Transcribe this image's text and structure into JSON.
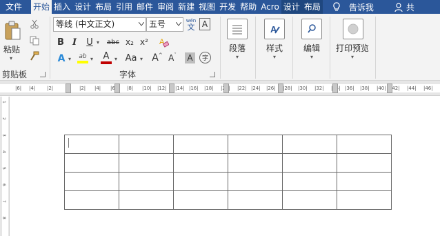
{
  "tabs": [
    {
      "label": "文件",
      "state": "normal"
    },
    {
      "label": "开始",
      "state": "active"
    },
    {
      "label": "插入",
      "state": "normal"
    },
    {
      "label": "设计",
      "state": "normal"
    },
    {
      "label": "布局",
      "state": "normal"
    },
    {
      "label": "引用",
      "state": "normal"
    },
    {
      "label": "邮件",
      "state": "normal"
    },
    {
      "label": "审阅",
      "state": "normal"
    },
    {
      "label": "新建",
      "state": "normal"
    },
    {
      "label": "视图",
      "state": "normal"
    },
    {
      "label": "开发",
      "state": "normal"
    },
    {
      "label": "帮助",
      "state": "normal"
    },
    {
      "label": "Acro",
      "state": "normal"
    },
    {
      "label": "设计",
      "state": "context"
    },
    {
      "label": "布局",
      "state": "context"
    }
  ],
  "tell_me": "告诉我",
  "share": "共",
  "clipboard": {
    "paste": "粘贴",
    "group_label": "剪贴板"
  },
  "font": {
    "name": "等线 (中文正文)",
    "size": "五号",
    "phonetic_top": "wén",
    "phonetic_bottom": "文",
    "bold": "B",
    "italic": "I",
    "underline": "U",
    "strike": "abc",
    "subscript": "x₂",
    "superscript": "x²",
    "effects": "A",
    "highlight": "ab",
    "color": "A",
    "case": "Aa",
    "grow": "A",
    "shrink": "A",
    "shade": "A",
    "enclose": "字",
    "group_label": "字体"
  },
  "paragraph": {
    "label": "段落"
  },
  "styles": {
    "label": "样式"
  },
  "editing": {
    "label": "编辑"
  },
  "print_preview": {
    "label": "打印预览"
  },
  "colors": {
    "accent": "#2b579a",
    "highlight": "#ffff00",
    "font_color": "#c00000"
  },
  "ruler": {
    "labels": [
      "|6|",
      "|4|",
      "|2|",
      "|2|",
      "|4|",
      "|6|",
      "|8|",
      "|10|",
      "|12|",
      "|14|",
      "|16|",
      "|18|",
      "|20|",
      "|22|",
      "|24|",
      "|26|",
      "|28|",
      "|30|",
      "|32|",
      "|34|",
      "|36|",
      "|38|",
      "|40|",
      "|42|",
      "|44|",
      "|46|"
    ],
    "vlabels": [
      "1",
      "2",
      "3",
      "4",
      "5",
      "6",
      "7",
      "8"
    ]
  },
  "table": {
    "rows": 4,
    "cols": 6,
    "cells": [
      [
        "",
        "",
        "",
        "",
        "",
        ""
      ],
      [
        "",
        "",
        "",
        "",
        "",
        ""
      ],
      [
        "",
        "",
        "",
        "",
        "",
        ""
      ],
      [
        "",
        "",
        "",
        "",
        "",
        ""
      ]
    ]
  }
}
